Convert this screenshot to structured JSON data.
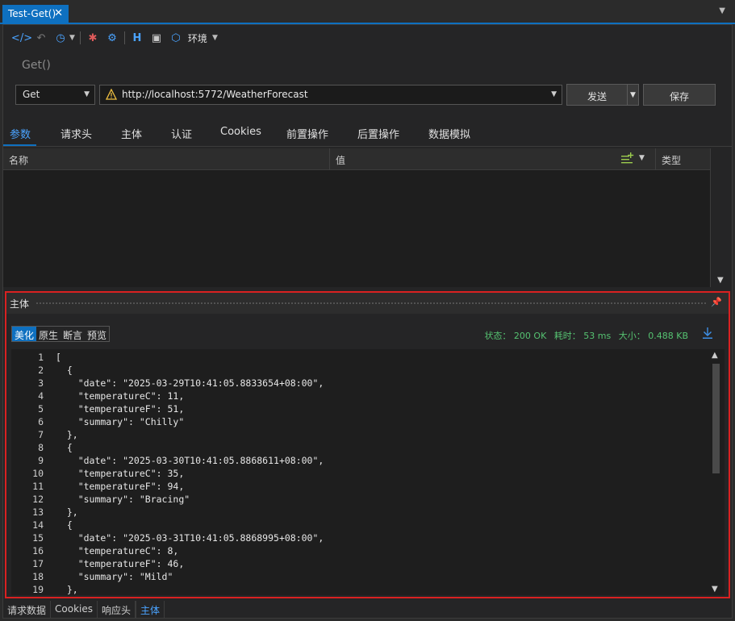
{
  "document_tab": {
    "title": "Test-Get()",
    "close": "✕"
  },
  "toolbar": {
    "environment_label": "环境"
  },
  "request": {
    "name": "Get()",
    "method": "Get",
    "url": "http://localhost:5772/WeatherForecast",
    "send_label": "发送",
    "save_label": "保存"
  },
  "request_tabs": [
    "参数",
    "请求头",
    "主体",
    "认证",
    "Cookies",
    "前置操作",
    "后置操作",
    "数据模拟"
  ],
  "params_grid": {
    "columns": {
      "name": "名称",
      "value": "值",
      "type": "类型"
    }
  },
  "response": {
    "panel_title": "主体",
    "view_tabs": [
      "美化",
      "原生",
      "断言",
      "预览"
    ],
    "status": "状态： 200 OK",
    "time": "耗时： 53 ms",
    "size": "大小： 0.488 KB",
    "lines": [
      "[",
      "  {",
      "    \"date\": \"2025-03-29T10:41:05.8833654+08:00\",",
      "    \"temperatureC\": 11,",
      "    \"temperatureF\": 51,",
      "    \"summary\": \"Chilly\"",
      "  },",
      "  {",
      "    \"date\": \"2025-03-30T10:41:05.8868611+08:00\",",
      "    \"temperatureC\": 35,",
      "    \"temperatureF\": 94,",
      "    \"summary\": \"Bracing\"",
      "  },",
      "  {",
      "    \"date\": \"2025-03-31T10:41:05.8868995+08:00\",",
      "    \"temperatureC\": 8,",
      "    \"temperatureF\": 46,",
      "    \"summary\": \"Mild\"",
      "  },"
    ]
  },
  "bottom_tabs": [
    "请求数据",
    "Cookies",
    "响应头",
    "主体"
  ],
  "colors": {
    "accent": "#0e70c0",
    "status_green": "#55c271",
    "highlight_border": "#d92121"
  }
}
